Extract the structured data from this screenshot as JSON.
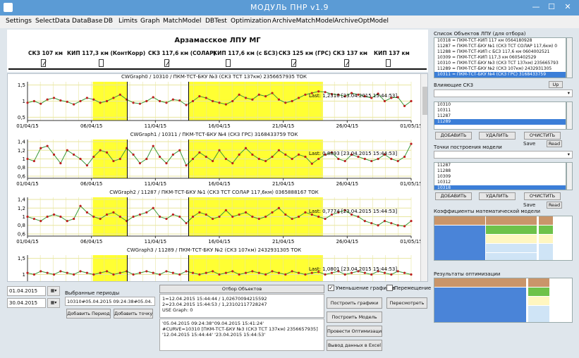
{
  "window": {
    "title": "МОДУЛЬ ПНР v1.9",
    "minimize": "—",
    "maximize": "☐",
    "close": "✕"
  },
  "menu": [
    "Settings",
    "SelectData",
    "DataBase",
    "DB",
    "Limits",
    "Graph",
    "MatchModel",
    "DBTest",
    "Optimization",
    "ArchiveMatchModel",
    "ArchiveOptModel"
  ],
  "schema": {
    "title": "Арзамасское ЛПУ МГ",
    "stations": [
      {
        "label": "СКЗ 107 км",
        "icon": "diagonal"
      },
      {
        "label": "КИП 117,3 км (КонтКорр)",
        "icon": "plain"
      },
      {
        "label": "СКЗ 117,6 км (СОЛАР)",
        "icon": "diagonal"
      },
      {
        "label": "КИП 117,6 км (с БСЗ)",
        "icon": "plain"
      },
      {
        "label": "СКЗ 125 км (ГРС)",
        "icon": "diagonal"
      },
      {
        "label": "СКЗ 137 км",
        "icon": "diagonal"
      },
      {
        "label": "КИП 137 км",
        "icon": "plain"
      }
    ]
  },
  "charts": [
    {
      "title": "CWGraph0 / 10310 / ПКМ-ТСТ-БКУ №3 (СКЗ ТСТ 137км) 2356657935 ТОК",
      "yticks": [
        "1,5",
        "1",
        "0,5"
      ],
      "ymin": 0.4,
      "ymax": 1.6,
      "last": "Last: 1,2310 [23.04.2015 15:44:53]",
      "values": [
        0.95,
        1.0,
        0.92,
        1.05,
        1.1,
        1.02,
        0.98,
        0.9,
        1.0,
        1.1,
        1.05,
        0.95,
        1.0,
        1.1,
        1.2,
        1.05,
        0.95,
        0.92,
        1.0,
        1.12,
        1.0,
        0.95,
        1.05,
        1.02,
        0.88,
        1.0,
        1.15,
        1.1,
        1.0,
        0.95,
        0.9,
        1.0,
        1.2,
        1.1,
        1.05,
        1.2,
        1.15,
        1.25,
        1.05,
        0.95,
        1.0,
        1.1,
        1.2,
        1.25,
        1.3,
        1.28,
        1.22,
        1.2,
        1.15,
        1.25,
        1.2,
        1.15,
        1.1,
        1.23,
        1.0,
        1.1,
        1.12,
        0.85,
        1.0
      ]
    },
    {
      "title": "CWGraph1 / 10311 / ПКМ-ТСТ-БКУ №4 (СКЗ ГРС) 3168433759 ТОК",
      "yticks": [
        "1,4",
        "1,2",
        "1",
        "0,8",
        "0,6"
      ],
      "ymin": 0.55,
      "ymax": 1.45,
      "last": "Last: 0,8893 [23.04.2015 15:44:53]",
      "values": [
        1.0,
        0.95,
        1.25,
        1.3,
        1.1,
        0.9,
        1.2,
        1.1,
        1.0,
        0.85,
        1.05,
        1.2,
        1.15,
        0.95,
        1.0,
        1.25,
        1.1,
        0.9,
        1.0,
        1.3,
        1.05,
        0.9,
        1.1,
        1.2,
        0.85,
        1.0,
        1.15,
        1.05,
        0.95,
        1.2,
        1.0,
        0.9,
        1.1,
        1.25,
        1.1,
        1.0,
        0.95,
        1.05,
        1.2,
        1.1,
        1.0,
        1.1,
        1.05,
        0.89,
        1.0,
        1.1,
        1.15,
        1.0,
        0.95,
        1.1,
        1.05,
        1.0,
        0.95,
        1.0,
        1.1,
        1.0,
        0.95,
        1.05,
        1.35
      ]
    },
    {
      "title": "CWGraph2 / 11287 / ПКМ-ТСТ-БКУ №1 (СКЗ ТСТ СОЛАР 117,6км) 0365888167 ТОК",
      "yticks": [
        "1,4",
        "1,2",
        "1",
        "0,8",
        "0,6"
      ],
      "ymin": 0.55,
      "ymax": 1.45,
      "last": "Last: 0,7774 [23.04.2015 15:44:53]",
      "values": [
        1.0,
        0.95,
        0.9,
        1.0,
        1.05,
        1.0,
        0.9,
        0.95,
        1.25,
        1.1,
        1.0,
        0.95,
        1.05,
        1.1,
        1.0,
        0.9,
        1.0,
        1.05,
        1.1,
        1.2,
        1.0,
        0.95,
        1.05,
        1.0,
        0.85,
        1.0,
        1.1,
        1.05,
        0.95,
        1.0,
        1.15,
        1.0,
        1.05,
        1.1,
        1.0,
        0.95,
        1.0,
        1.1,
        1.2,
        1.05,
        0.95,
        1.0,
        1.1,
        1.05,
        1.0,
        0.95,
        1.05,
        1.1,
        1.15,
        1.05,
        1.0,
        0.9,
        0.85,
        0.8,
        0.9,
        0.85,
        0.8,
        0.78,
        0.9
      ]
    },
    {
      "title": "CWGraph3 / 11289 / ПКМ-ТСТ-БКУ №2 (СКЗ 107км) 2432931305 ТОК",
      "yticks": [
        "1,5",
        "1"
      ],
      "ymin": 0.4,
      "ymax": 1.6,
      "last": "Last: 1,0801 [23.04.2015 15:44:53]",
      "values": [
        1.05,
        1.0,
        1.1,
        1.05,
        1.0,
        1.1,
        1.05,
        1.0,
        1.1,
        1.05,
        1.0,
        1.05,
        1.1,
        1.0,
        1.05,
        1.1,
        1.0,
        1.05,
        1.1,
        1.05,
        1.0,
        1.1,
        1.05,
        1.0,
        1.1,
        1.05,
        1.0,
        1.05,
        1.1,
        1.0,
        1.05,
        1.1,
        1.0,
        1.05,
        1.1,
        1.05,
        1.0,
        1.1,
        1.05,
        1.0,
        1.1,
        1.05,
        1.0,
        1.05,
        1.08,
        1.0,
        1.05,
        1.1,
        1.0,
        1.05,
        1.1,
        1.05,
        1.0,
        1.1,
        1.05,
        1.0,
        1.1,
        1.05,
        1.0
      ]
    }
  ],
  "xticks": [
    "01/04/15",
    "06/04/15",
    "11/04/15",
    "16/04/15",
    "21/04/15",
    "26/04/15",
    "01/05/15"
  ],
  "colors": {
    "highlight": "#ffff33",
    "grid": "#e8e6a0",
    "line": "#3a9a3a",
    "point": "#c02020",
    "marker": "#000000"
  },
  "bottom": {
    "date1": "01.04.2015",
    "date2": "30.04.2015",
    "periods_label": "Выбранные периоды",
    "period_value": "10310#05.04.2015 09:24:38#05.04.",
    "add_period": "Добавить Период",
    "add_point": "Добавить точку",
    "select_objects": "Отбор Объектов",
    "text1": "1=12.04.2015 15:44:44 / 1,02670094215592\n2=23.04.2015 15:44:53 / 1,23102117728247\nUSE Graph: 0",
    "text2": "'05.04.2015 09:24:38''09.04.2015 15:41:24'\n#CURVE=10310 [ПКМ-ТСТ-БКУ №3 (СКЗ ТСТ 137км) 2356657935]\n'12.04.2015 15:44:44' '23.04.2015 15:44:53'",
    "zoom_graphs": "Уменьшение графиков",
    "moving": "Перемещение",
    "build_graphs": "Построить графики",
    "build_model": "Построить Модель",
    "optimization": "Провести Оптимизацию",
    "export_excel": "Вывод данных в Excel",
    "recalc": "Пересмотреть"
  },
  "right": {
    "objects_label": "Список Объектов ЛПУ (для отбора)",
    "objects": [
      "10318 = ПКМ-ТСТ-КИП 117 км 0564180928",
      "11287 = ПКМ-ТСТ-БКУ №1 (СКЗ ТСТ СОЛАР 117,6км) 0",
      "11288 = ПКМ-ТСТ-КИП с БСЗ 117,6 км 0604002521",
      "10309 = ПКМ-ТСТ-КИП 117,3 км 0605402529",
      "10310 = ПКМ-ТСТ-БКУ №3 (СКЗ ТСТ 137км) 235665793",
      "11289 = ПКМ-ТСТ-БКУ №2 (СКЗ 107км) 2432931305",
      "10311 = ПКМ-ТСТ-БКУ №4 (СКЗ ГРС) 3168433759"
    ],
    "selected_object": 6,
    "skz_label": "Влияющие СКЗ",
    "up": "Up",
    "skz_list": [
      "10310",
      "10311",
      "11287",
      "11289"
    ],
    "selected_skz": 3,
    "add": "ДОБАВИТЬ",
    "delete": "УДАЛИТЬ",
    "clear": "ОЧИСТИТЬ",
    "save": "Save",
    "read": "Read",
    "points_label": "Точки построения модели",
    "points_list": [
      "11287",
      "11288",
      "10309",
      "10312",
      "10318"
    ],
    "selected_point": 4,
    "coef_label": "Коэффициенты математической модели",
    "results_label": "Результаты оптимизации"
  }
}
